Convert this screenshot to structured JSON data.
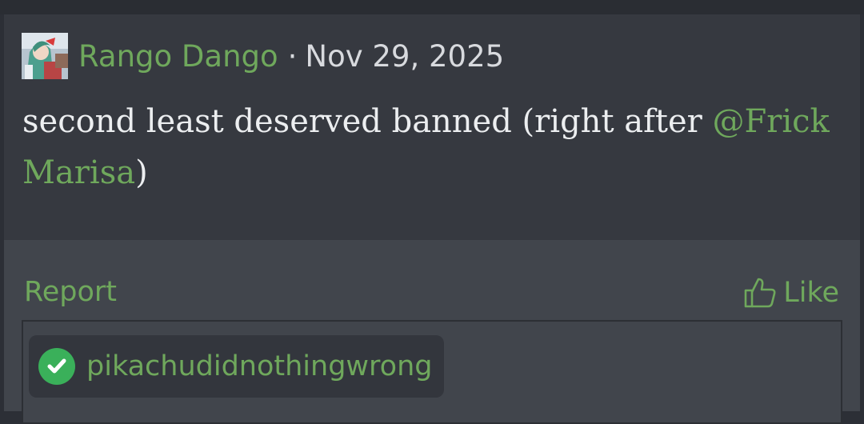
{
  "post": {
    "author": "Rango Dango",
    "separator": "·",
    "date": "Nov 29, 2025",
    "message_text": "second least deserved banned (right after ",
    "mention": "@Frick Marisa",
    "message_tail": ")",
    "avatar_icon": "user-avatar-icon"
  },
  "footer": {
    "report_label": "Report",
    "like_label": "Like",
    "like_icon": "thumbs-up-icon"
  },
  "tags": {
    "items": [
      {
        "label": "pikachudidnothingwrong",
        "icon": "check-circle-icon"
      }
    ]
  },
  "colors": {
    "accent": "#6fa85c",
    "check": "#3ab05a",
    "background": "#2c2f36",
    "post_bg": "#363940",
    "footer_bg": "#41454c"
  }
}
